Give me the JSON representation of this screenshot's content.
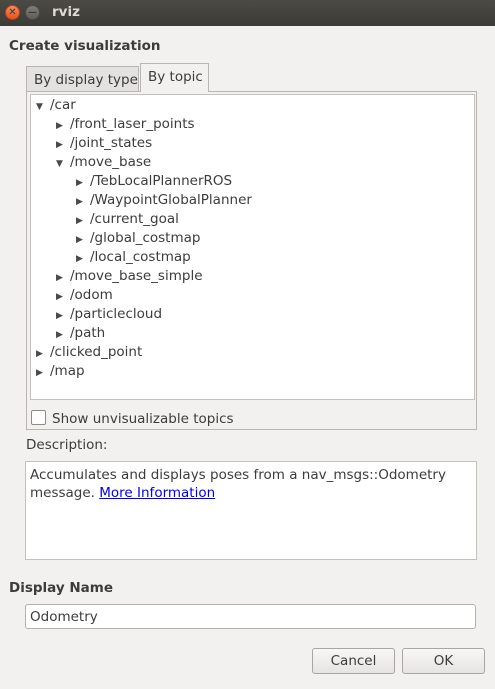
{
  "window": {
    "title": "rviz",
    "close_glyph": "✕",
    "minimize_glyph": "—"
  },
  "dialog": {
    "heading": "Create visualization"
  },
  "tabs": [
    {
      "label": "By display type",
      "active": false
    },
    {
      "label": "By topic",
      "active": true
    }
  ],
  "tree": [
    {
      "label": "/car",
      "expanded": true,
      "depth": 0
    },
    {
      "label": "/front_laser_points",
      "expanded": false,
      "depth": 1
    },
    {
      "label": "/joint_states",
      "expanded": false,
      "depth": 1
    },
    {
      "label": "/move_base",
      "expanded": true,
      "depth": 1
    },
    {
      "label": "/TebLocalPlannerROS",
      "expanded": false,
      "depth": 2
    },
    {
      "label": "/WaypointGlobalPlanner",
      "expanded": false,
      "depth": 2
    },
    {
      "label": "/current_goal",
      "expanded": false,
      "depth": 2
    },
    {
      "label": "/global_costmap",
      "expanded": false,
      "depth": 2
    },
    {
      "label": "/local_costmap",
      "expanded": false,
      "depth": 2
    },
    {
      "label": "/move_base_simple",
      "expanded": false,
      "depth": 1
    },
    {
      "label": "/odom",
      "expanded": false,
      "depth": 1
    },
    {
      "label": "/particlecloud",
      "expanded": false,
      "depth": 1
    },
    {
      "label": "/path",
      "expanded": false,
      "depth": 1
    },
    {
      "label": "/clicked_point",
      "expanded": false,
      "depth": 0
    },
    {
      "label": "/map",
      "expanded": false,
      "depth": 0
    }
  ],
  "show_unvisualizable": {
    "label": "Show unvisualizable topics",
    "checked": false
  },
  "description": {
    "label": "Description:",
    "text": "Accumulates and displays poses from a nav_msgs::Odometry message.",
    "link": "More Information"
  },
  "display_name": {
    "label": "Display Name",
    "value": "Odometry"
  },
  "buttons": {
    "cancel": "Cancel",
    "ok": "OK"
  },
  "icons": {
    "expanded": "triangle-down-icon",
    "collapsed": "triangle-right-icon"
  },
  "colors": {
    "titlebar": "#3c3b37",
    "close": "#e5531f",
    "link": "#0000ee"
  }
}
